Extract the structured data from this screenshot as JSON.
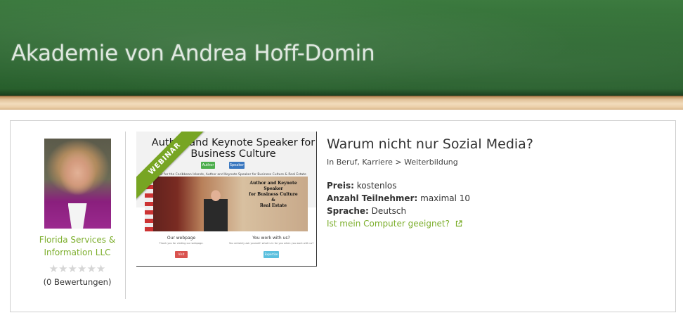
{
  "banner": {
    "title": "Akademie von Andrea Hoff-Domin"
  },
  "author": {
    "company_line1": "Florida Services &",
    "company_line2": "Information LLC",
    "stars": "★★★★★★",
    "reviews": "(0 Bewertungen)"
  },
  "thumbnail": {
    "badge": "WEBINAR",
    "headline_line1": "Author and Keynote Speaker for",
    "headline_line2": "Business Culture",
    "button1": "Author",
    "button2": "Speaker",
    "subline": "Counselor for the Caribbean Islands, Author and Keynote Speaker for Business Culture & Real Estate",
    "overlay_line1": "Author and Keynote Speaker",
    "overlay_line2": "for Business Culture",
    "overlay_line3": "&",
    "overlay_line4": "Real Estate",
    "footer_left_heading": "Our webpage",
    "footer_left_text": "Thank you for visiting our webpage.",
    "footer_left_button": "Visit",
    "footer_right_heading": "You work with us?",
    "footer_right_text": "You certainly ask yourself: what is in for you when you work with us?",
    "footer_right_button": "Expertise"
  },
  "course": {
    "title": "Warum nicht nur Sozial Media?",
    "breadcrumb": "In Beruf, Karriere > Weiterbildung",
    "price_label": "Preis:",
    "price_value": "kostenlos",
    "participants_label": "Anzahl Teilnehmer:",
    "participants_value": "maximal 10",
    "language_label": "Sprache:",
    "language_value": "Deutsch",
    "computer_check_link": "Ist mein Computer geeignet?"
  },
  "colors": {
    "accent": "#7cae2c",
    "ribbon": "#77a523"
  },
  "icons": {
    "external_link": "external-link-icon"
  }
}
